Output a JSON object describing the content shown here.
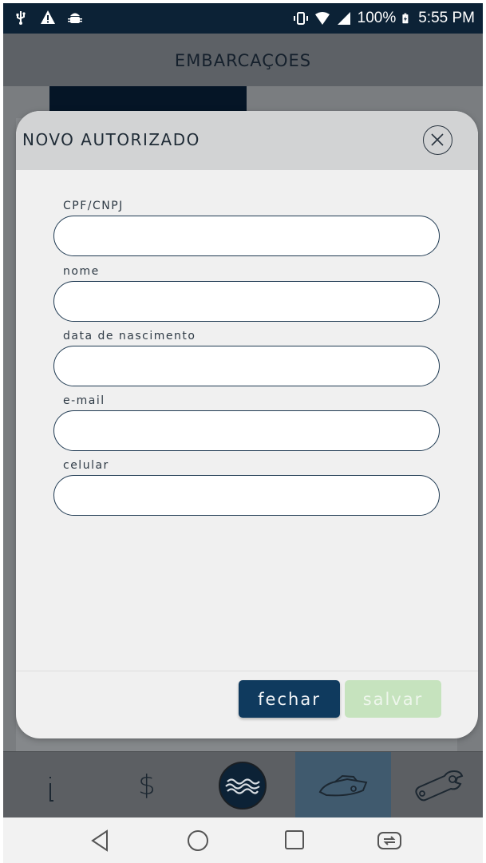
{
  "status_bar": {
    "left_icons": [
      "usb-icon",
      "warning-icon",
      "android-debug-icon"
    ],
    "battery_percent": "100%",
    "time": "5:55 PM"
  },
  "app": {
    "title": "EMBARCAÇOES"
  },
  "modal": {
    "title": "NOVO AUTORIZADO",
    "fields": [
      {
        "label": "CPF/CNPJ",
        "value": ""
      },
      {
        "label": "nome",
        "value": ""
      },
      {
        "label": "data de nascimento",
        "value": ""
      },
      {
        "label": "e-mail",
        "value": ""
      },
      {
        "label": "celular",
        "value": ""
      }
    ],
    "buttons": {
      "close_label": "fechar",
      "save_label": "salvar"
    }
  },
  "bottom_nav": {
    "items": [
      {
        "icon": "info-icon",
        "glyph": "i",
        "active": false
      },
      {
        "icon": "dollar-icon",
        "glyph": "$",
        "active": false
      },
      {
        "icon": "waves-icon",
        "active": false
      },
      {
        "icon": "boat-icon",
        "active": true
      },
      {
        "icon": "wrench-icon",
        "active": false
      }
    ]
  },
  "colors": {
    "primary": "#0f3a5e",
    "save_disabled": "#c6e3be",
    "active_nav": "#405a6e",
    "status_bar": "#0c2236"
  }
}
